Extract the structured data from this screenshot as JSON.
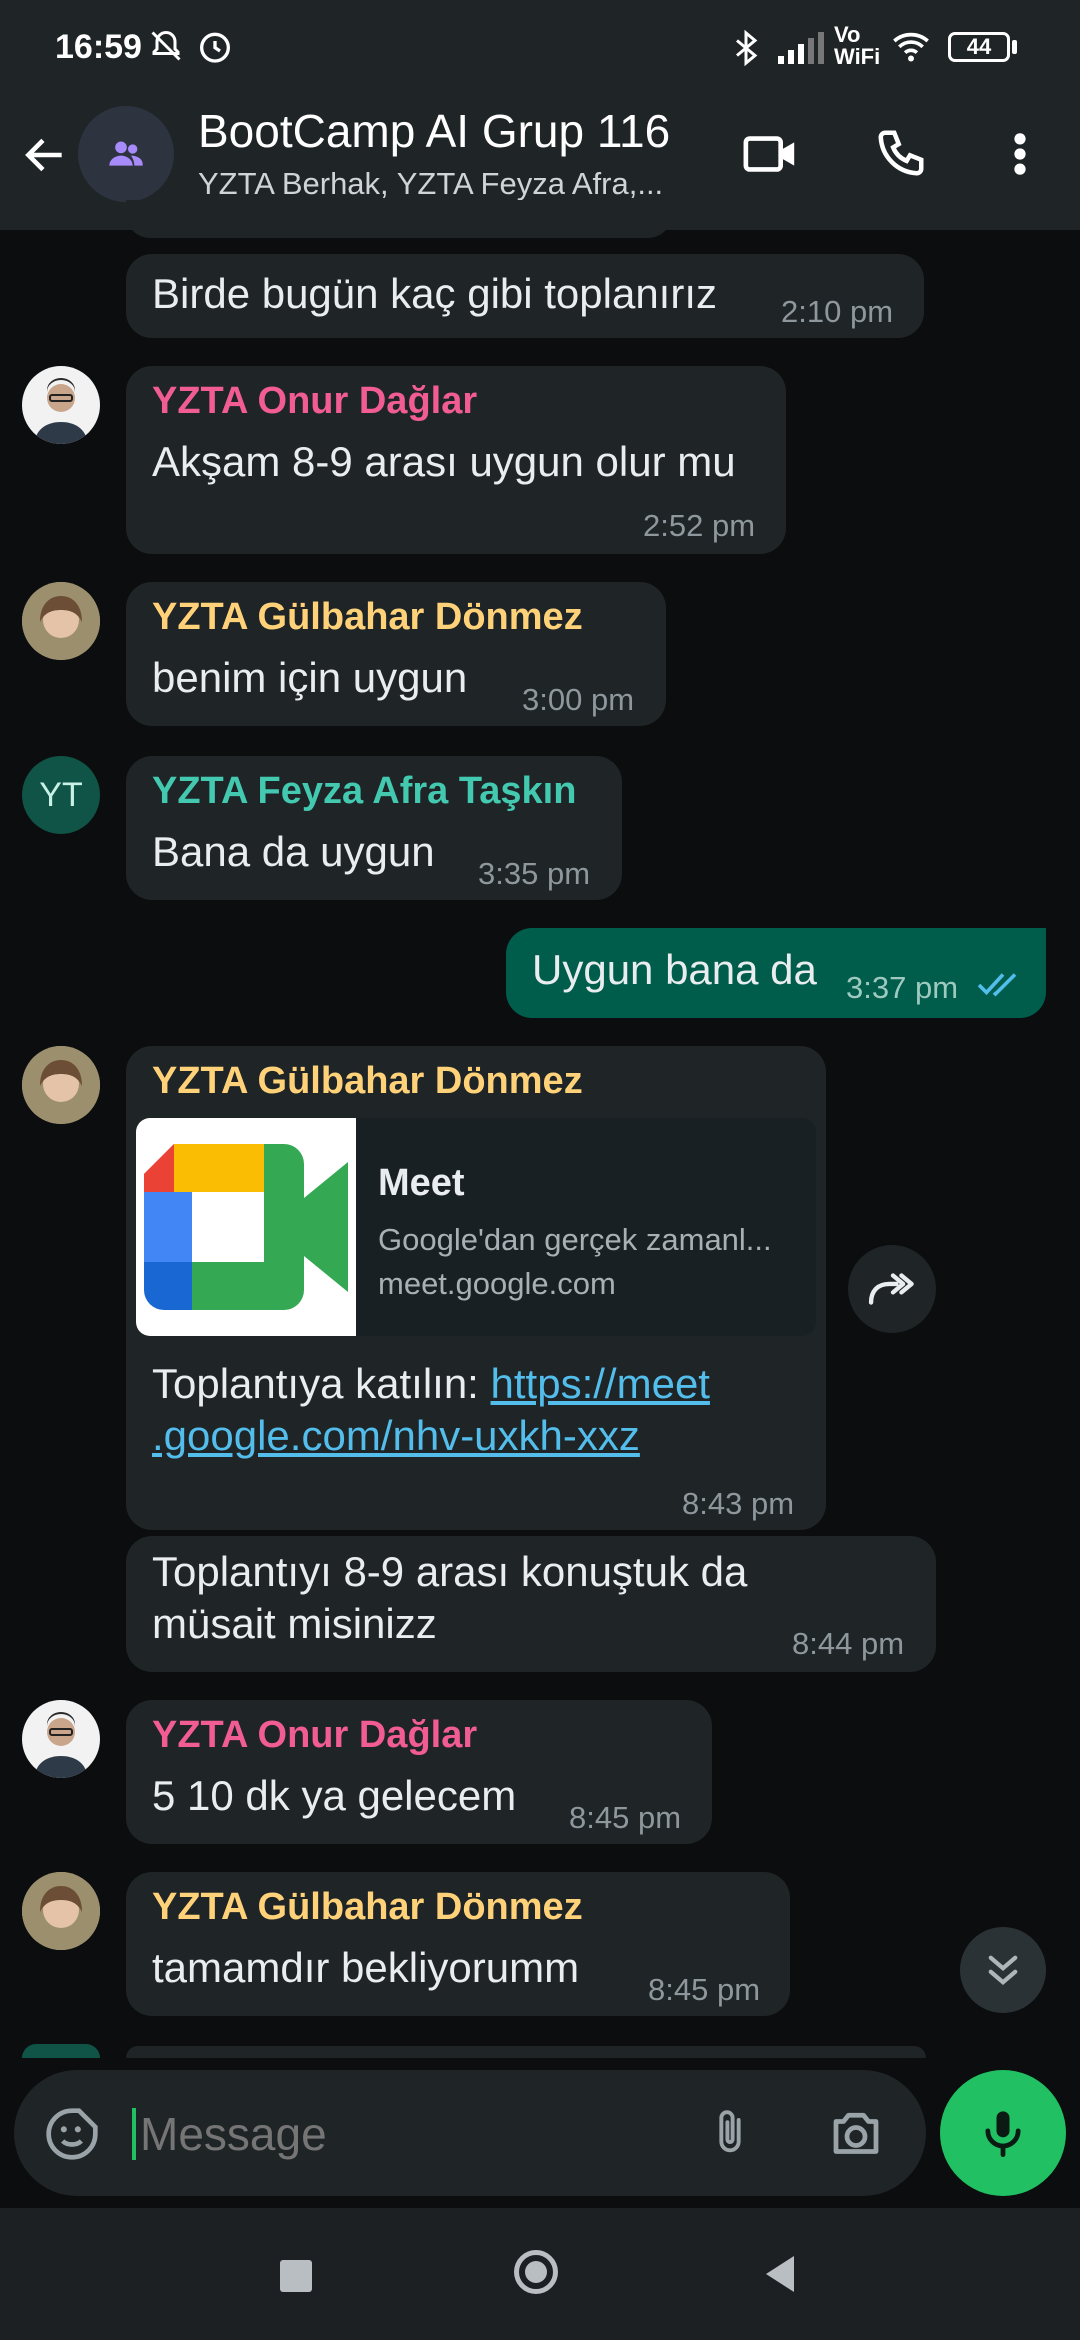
{
  "status_bar": {
    "time": "16:59",
    "battery": "44",
    "network": "Vo WiFi"
  },
  "header": {
    "title": "BootCamp AI Grup 116",
    "subtitle": "YZTA Berhak, YZTA Feyza Afra,..."
  },
  "messages": [
    {
      "text": "Birde bugün kaç gibi toplanırız",
      "time": "2:10 pm"
    },
    {
      "sender": "YZTA Onur Dağlar",
      "sender_color": "#f15c93",
      "text": "Akşam 8-9 arası uygun olur mu",
      "time": "2:52 pm"
    },
    {
      "sender": "YZTA Gülbahar Dönmez",
      "sender_color": "#ffd279",
      "text": "benim için uygun",
      "time": "3:00 pm"
    },
    {
      "sender": "YZTA Feyza Afra Taşkın",
      "sender_color": "#43c9b0",
      "avatar_initials": "YT",
      "text": "Bana da uygun",
      "time": "3:35 pm"
    },
    {
      "text": "Uygun bana da",
      "time": "3:37 pm",
      "outgoing": true
    },
    {
      "sender": "YZTA Gülbahar Dönmez",
      "sender_color": "#ffd279",
      "preview_title": "Meet",
      "preview_desc": "Google'dan gerçek zamanl...",
      "preview_domain": "meet.google.com",
      "text_prefix": "Toplantıya katılın: ",
      "link_line1": "https://meet",
      "link_line2": ".google.com/nhv-uxkh-xxz",
      "time": "8:43 pm"
    },
    {
      "line1": "Toplantıyı 8-9 arası konuştuk da",
      "line2": "müsait misinizz",
      "time": "8:44 pm"
    },
    {
      "sender": "YZTA Onur Dağlar",
      "sender_color": "#f15c93",
      "text": "5 10 dk ya gelecem",
      "time": "8:45 pm"
    },
    {
      "sender": "YZTA Gülbahar Dönmez",
      "sender_color": "#ffd279",
      "text": "tamamdır bekliyorumm",
      "time": "8:45 pm"
    }
  ],
  "composer": {
    "placeholder": "Message"
  },
  "colors": {
    "accent": "#21c063",
    "link": "#53bdeb",
    "outgoing": "#005c4b",
    "incoming": "#1f2427"
  }
}
